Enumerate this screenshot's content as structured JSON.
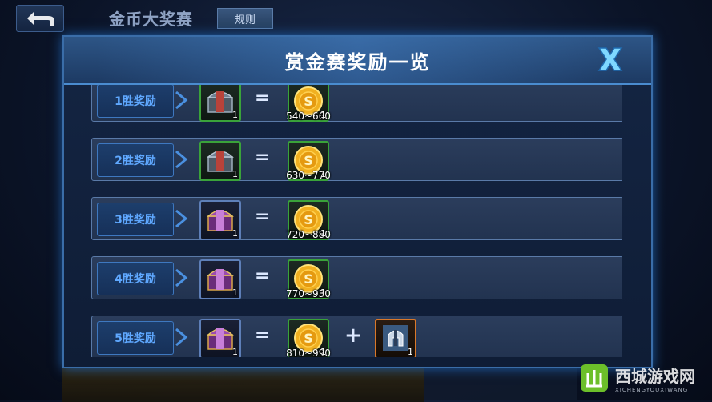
{
  "topbar": {
    "title": "金币大奖赛",
    "rules_label": "规则"
  },
  "dialog": {
    "title": "赏金赛奖励一览"
  },
  "rows": [
    {
      "label": "1胜奖励",
      "chest": "silver-chest",
      "chest_qty": "1",
      "gold": "540~660",
      "gold_qty": "1"
    },
    {
      "label": "2胜奖励",
      "chest": "silver-chest",
      "chest_qty": "1",
      "gold": "630~770",
      "gold_qty": "1"
    },
    {
      "label": "3胜奖励",
      "chest": "purple-chest",
      "chest_qty": "1",
      "gold": "720~880",
      "gold_qty": "1"
    },
    {
      "label": "4胜奖励",
      "chest": "purple-chest",
      "chest_qty": "1",
      "gold": "770~930",
      "gold_qty": "1"
    },
    {
      "label": "5胜奖励",
      "chest": "purple-chest",
      "chest_qty": "1",
      "gold": "810~990",
      "gold_qty": "1",
      "extra": "helmet-card",
      "extra_qty": "1"
    }
  ],
  "symbols": {
    "equals": "=",
    "plus": "+"
  },
  "watermark": {
    "main": "西城游戏网",
    "sub": "XICHENGYOUXIWANG"
  },
  "colors": {
    "accent": "#3a6da8",
    "label_blue": "#5fa8ff",
    "item_green": "#3aa33a",
    "item_orange": "#d9782a"
  }
}
